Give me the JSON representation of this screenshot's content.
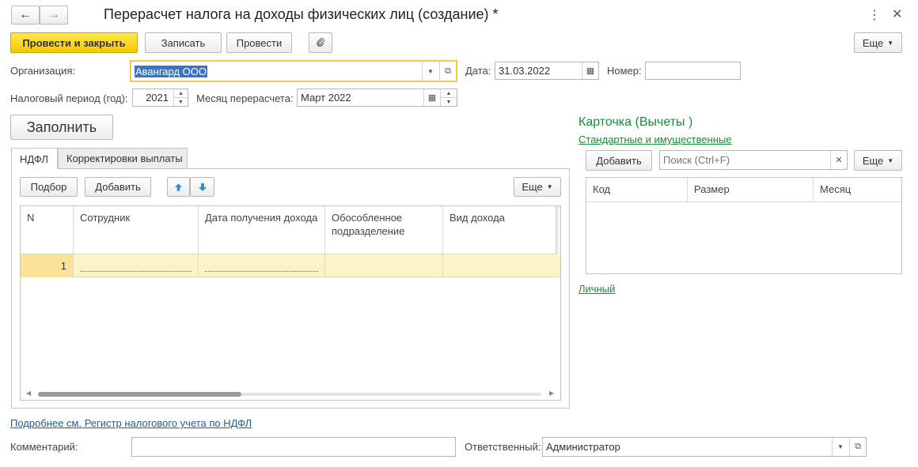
{
  "window": {
    "title": "Перерасчет налога на доходы физических лиц (создание) *"
  },
  "toolbar": {
    "post_close_label": "Провести и закрыть",
    "save_label": "Записать",
    "post_label": "Провести",
    "more_label": "Еще"
  },
  "form": {
    "organization_label": "Организация:",
    "organization_value": "Авангард ООО",
    "date_label": "Дата:",
    "date_value": "31.03.2022",
    "number_label": "Номер:",
    "number_value": "",
    "tax_period_label": "Налоговый период (год):",
    "tax_period_value": "2021",
    "recalc_month_label": "Месяц перерасчета:",
    "recalc_month_value": "Март 2022",
    "fill_button": "Заполнить"
  },
  "tabs": [
    {
      "label": "НДФЛ",
      "active": true
    },
    {
      "label": "Корректировки выплаты",
      "active": false
    }
  ],
  "table_toolbar": {
    "pick_label": "Подбор",
    "add_label": "Добавить",
    "more_label": "Еще"
  },
  "table": {
    "columns": [
      "N",
      "Сотрудник",
      "Дата получения дохода",
      "Обособленное подразделение",
      "Вид дохода"
    ],
    "rows": [
      {
        "n": "1",
        "employee": "",
        "date": "",
        "division": "",
        "income_type": ""
      }
    ]
  },
  "card": {
    "title": "Карточка (Вычеты )",
    "standard_link": "Стандартные и имущественные",
    "add_label": "Добавить",
    "search_placeholder": "Поиск (Ctrl+F)",
    "more_label": "Еще",
    "columns": [
      "Код",
      "Размер",
      "Месяц"
    ],
    "personal_link": "Личный"
  },
  "footer": {
    "details_link": "Подробнее см. Регистр налогового учета по НДФЛ",
    "comment_label": "Комментарий:",
    "comment_value": "",
    "responsible_label": "Ответственный:",
    "responsible_value": "Администратор"
  },
  "colors": {
    "accent_yellow": "#f5c900",
    "link_blue": "#1b5ea8",
    "link_green": "#1a8f3a",
    "selected_row": "#fdf3c8",
    "focus_border": "#f2c94c"
  }
}
